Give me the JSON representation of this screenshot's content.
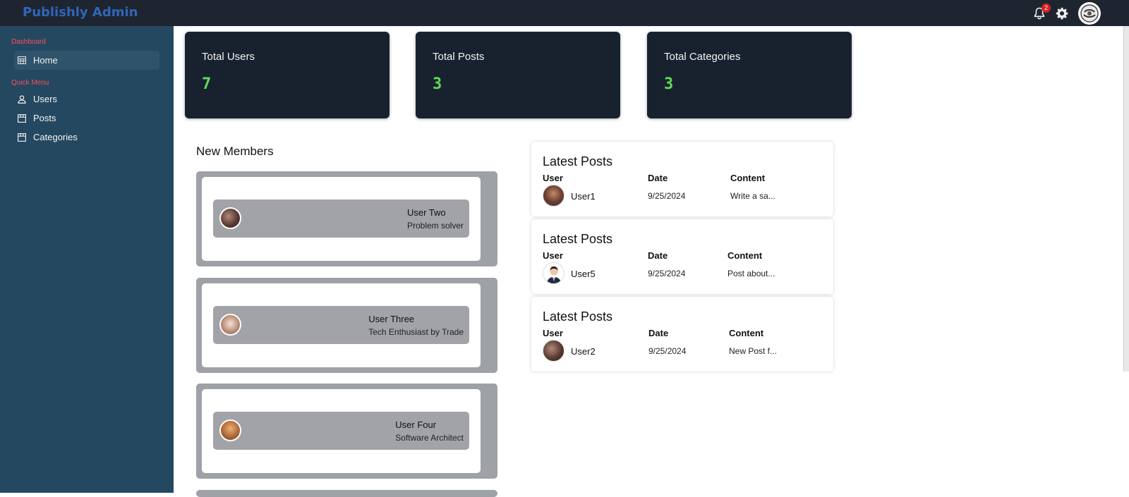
{
  "app": {
    "title": "Publishly Admin"
  },
  "topbar": {
    "notification_count": "2",
    "icons": [
      "bell-icon",
      "gear-icon",
      "profile-avatar"
    ]
  },
  "sidebar": {
    "sections": [
      {
        "title": "Dashboard",
        "items": [
          {
            "label": "Home",
            "icon": "table-icon",
            "active": true
          }
        ]
      },
      {
        "title": "Quick Menu",
        "items": [
          {
            "label": "Users",
            "icon": "user-icon"
          },
          {
            "label": "Posts",
            "icon": "store-icon"
          },
          {
            "label": "Categories",
            "icon": "store-icon"
          }
        ]
      }
    ]
  },
  "stats": [
    {
      "label": "Total Users",
      "value": "7"
    },
    {
      "label": "Total Posts",
      "value": "3"
    },
    {
      "label": "Total Categories",
      "value": "3"
    }
  ],
  "new_members": {
    "title": "New Members",
    "items": [
      {
        "name": "User Two",
        "role": "Problem solver"
      },
      {
        "name": "User Three",
        "role": "Tech Enthusiast by Trade"
      },
      {
        "name": "User Four",
        "role": "Software Architect"
      }
    ]
  },
  "latest_posts": [
    {
      "title": "Latest Posts",
      "headers": [
        "User",
        "Date",
        "Content"
      ],
      "user": "User1",
      "date": "9/25/2024",
      "content": "Write a sa..."
    },
    {
      "title": "Latest Posts",
      "headers": [
        "User",
        "Date",
        "Content"
      ],
      "user": "User5",
      "date": "9/25/2024",
      "content": "Post about..."
    },
    {
      "title": "Latest Posts",
      "headers": [
        "User",
        "Date",
        "Content"
      ],
      "user": "User2",
      "date": "9/25/2024",
      "content": "New Post f..."
    }
  ],
  "colors": {
    "topbar": "#1f2530",
    "sidebar": "#244860",
    "brand": "#2f66b8",
    "stat_value": "#5fdc58",
    "section_label": "#ff4d5e"
  }
}
